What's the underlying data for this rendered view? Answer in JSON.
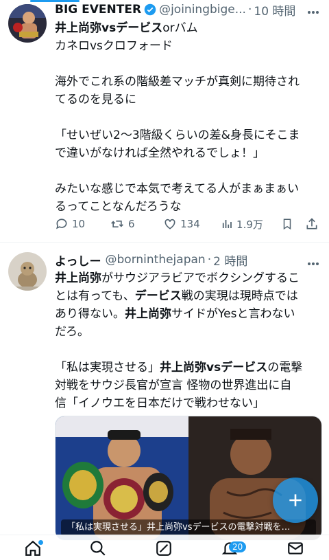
{
  "tweet1": {
    "display_name": "BIG EVENTER",
    "handle": "@joiningbige...",
    "dot": "·",
    "time": "10 時間",
    "lines": [
      "カネロvsクロフォード",
      "",
      "海外でこれ系の階級差マッチが真剣に期待され",
      "てるのを見るに",
      "",
      "「せいぜい2〜3階級くらいの差&身長にそこま",
      "で違いがなければ全然やれるでしょ！」",
      "",
      "みたいな感じで本気で考えてる人がまぁまぁい",
      "るってことなんだろうな"
    ],
    "line1_bold": "井上尚弥vsデービス",
    "line1_rest": "orバム",
    "replies": "10",
    "retweets": "6",
    "likes": "134",
    "views": "1.9万"
  },
  "tweet2": {
    "display_name": "よっしー",
    "handle": "@borninthejapan",
    "dot": "·",
    "time": "2 時間",
    "p1": {
      "b1": "井上尚弥",
      "t1": "がサウジアラビアでボクシングするこ",
      "t2": "とは有っても、",
      "b2": "デービス",
      "t3": "戦の実現は現時点では",
      "t4": "あり得ない。",
      "b3": "井上尚弥",
      "t5": "サイドがYesと言わない",
      "t6": "だろ。"
    },
    "p2": {
      "t1": "「私は実現させる」",
      "b1": "井上尚弥vsデービス",
      "t2": "の電撃",
      "t3": "対戦をサウジ長官が宣言 怪物の世界進出に自",
      "t4": "信「イノウエを日本だけで戦わせない」"
    },
    "media_caption": "「私は実現させる」井上尚弥vsデービスの電撃対戦を…"
  },
  "tabbar": {
    "notif_badge": "20"
  },
  "colors": {
    "accent": "#1d9bf0",
    "text": "#0f1419",
    "muted": "#536471"
  }
}
